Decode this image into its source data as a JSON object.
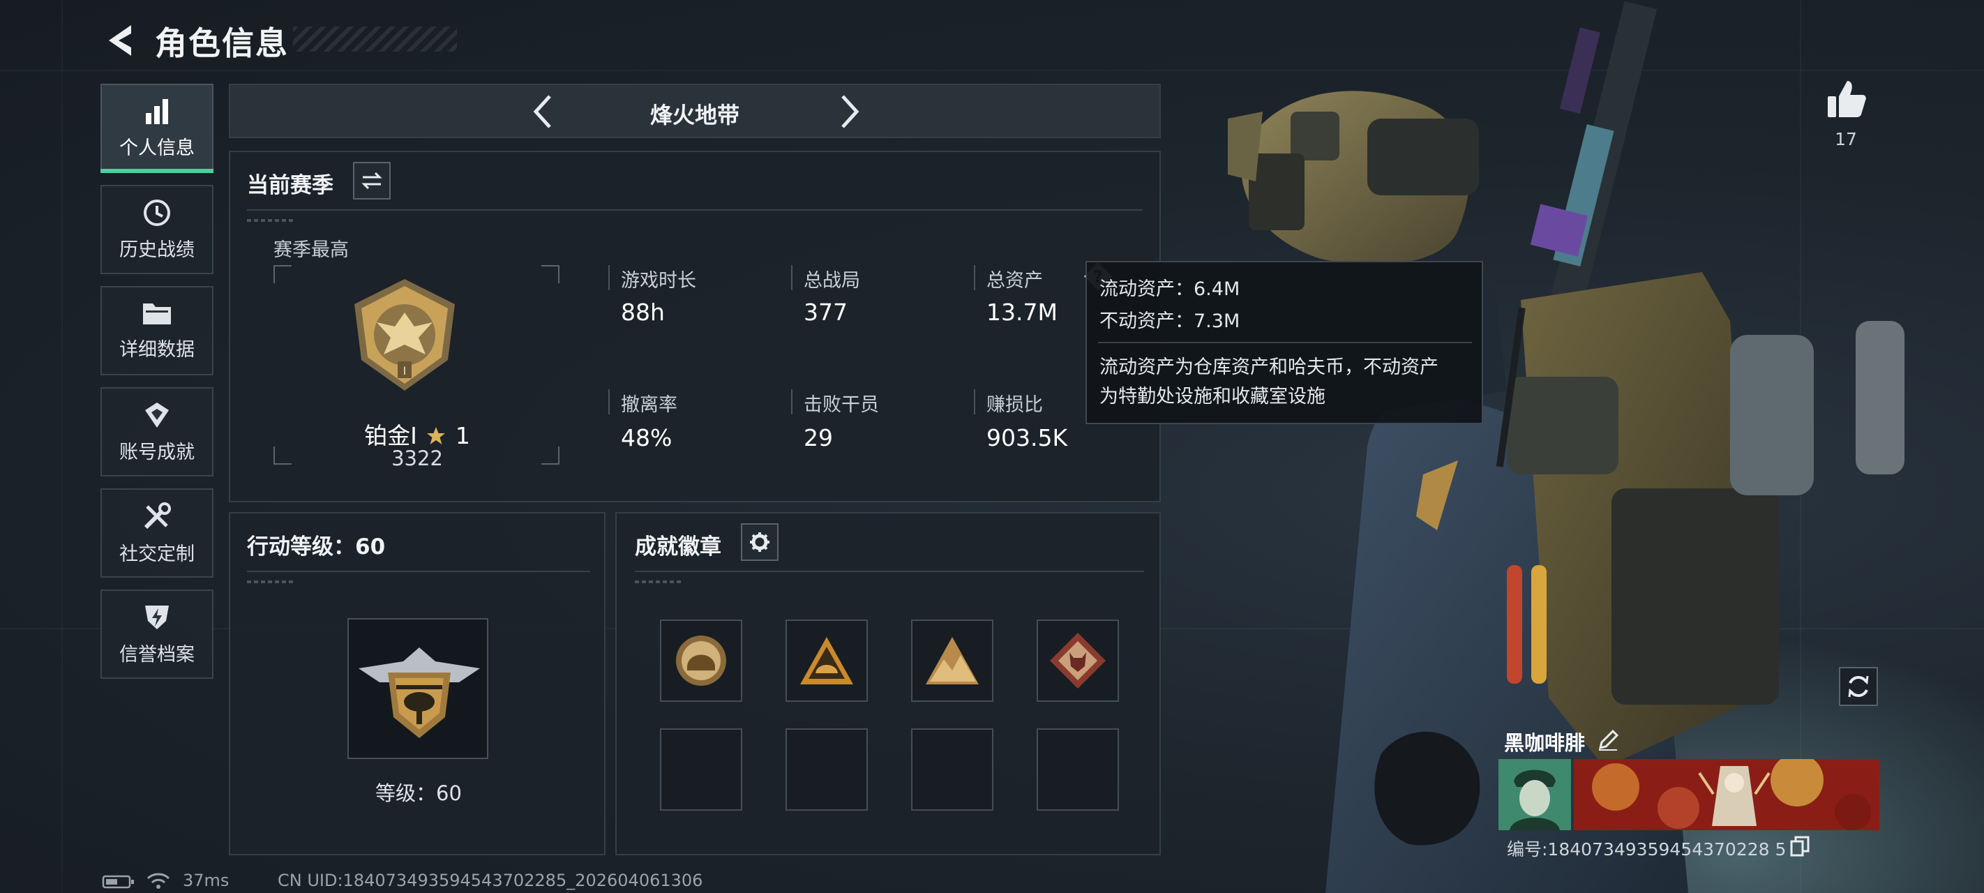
{
  "header": {
    "title": "角色信息"
  },
  "sidebar": {
    "items": [
      {
        "label": "个人信息",
        "icon": "bar-chart-icon",
        "active": true
      },
      {
        "label": "历史战绩",
        "icon": "clock-icon"
      },
      {
        "label": "详细数据",
        "icon": "folder-icon"
      },
      {
        "label": "账号成就",
        "icon": "achievement-icon"
      },
      {
        "label": "社交定制",
        "icon": "tools-icon"
      },
      {
        "label": "信誉档案",
        "icon": "shield-bolt-icon"
      }
    ]
  },
  "mode_nav": {
    "title": "烽火地带"
  },
  "season": {
    "title": "当前赛季",
    "best_label": "赛季最高",
    "rank_name": "铂金I",
    "rank_stars": "1",
    "rank_score": "3322",
    "stats": [
      {
        "label": "游戏时长",
        "value": "88h"
      },
      {
        "label": "总战局",
        "value": "377"
      },
      {
        "label": "总资产",
        "value": "13.7M"
      },
      {
        "label": "撤离率",
        "value": "48%"
      },
      {
        "label": "击败干员",
        "value": "29"
      },
      {
        "label": "赚损比",
        "value": "903.5K"
      }
    ]
  },
  "tooltip": {
    "line1": "流动资产：6.4M",
    "line2": "不动资产：7.3M",
    "desc1": "流动资产为仓库资产和哈夫币，不动资产",
    "desc2": "为特勤处设施和收藏室设施"
  },
  "action_level": {
    "title": "行动等级：60",
    "level_text": "等级：60"
  },
  "achievements": {
    "title": "成就徽章",
    "badges": [
      "helmet-badge-icon",
      "triangle-helmet-badge-icon",
      "mountain-badge-icon",
      "wolf-badge-icon"
    ]
  },
  "profile": {
    "like_count": "17",
    "player_name": "黑咖啡腓",
    "id_text": "编号:18407349359454370228 5"
  },
  "status_bar": {
    "ping": "37ms",
    "uid": "CN UID:184073493594543702285_202604061306"
  },
  "colors": {
    "accent": "#45d4a0",
    "gold": "#c9a25a",
    "panel": "#1c232a"
  }
}
